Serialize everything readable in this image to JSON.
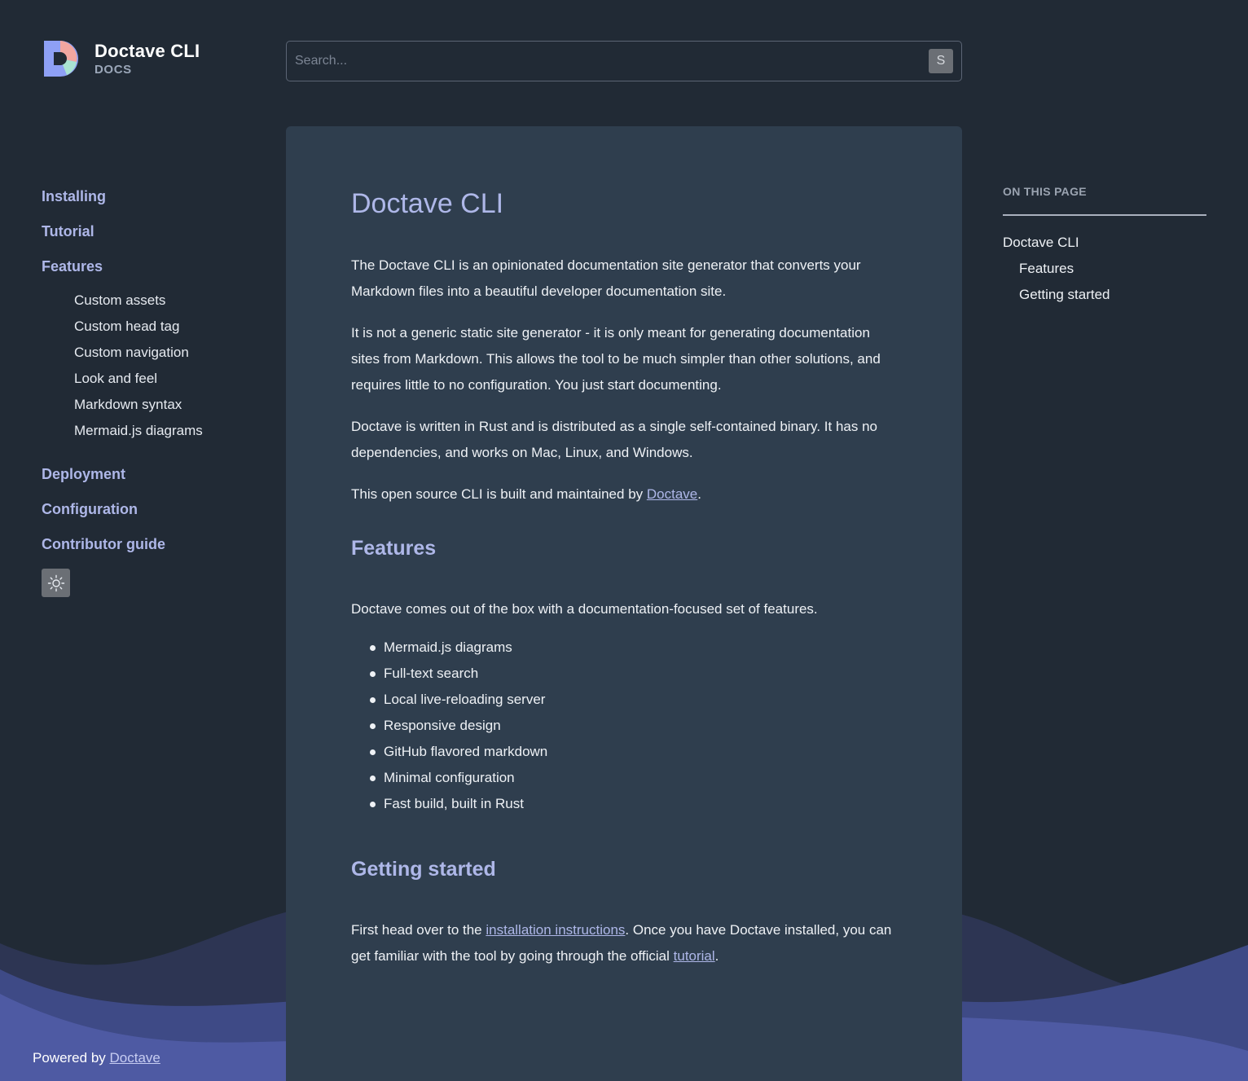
{
  "brand": {
    "title": "Doctave CLI",
    "subtitle": "DOCS"
  },
  "search": {
    "placeholder": "Search...",
    "shortcut_key": "S"
  },
  "sidebar": {
    "top_items": [
      {
        "label": "Installing"
      },
      {
        "label": "Tutorial"
      },
      {
        "label": "Features"
      }
    ],
    "feature_subitems": [
      {
        "label": "Custom assets"
      },
      {
        "label": "Custom head tag"
      },
      {
        "label": "Custom navigation"
      },
      {
        "label": "Look and feel"
      },
      {
        "label": "Markdown syntax"
      },
      {
        "label": "Mermaid.js diagrams"
      }
    ],
    "bottom_items": [
      {
        "label": "Deployment"
      },
      {
        "label": "Configuration"
      },
      {
        "label": "Contributor guide"
      }
    ],
    "theme_toggle_icon": "sun-icon"
  },
  "article": {
    "title": "Doctave CLI",
    "intro_1": "The Doctave CLI is an opinionated documentation site generator that converts your Markdown files into a beautiful developer documentation site.",
    "intro_2": "It is not a generic static site generator - it is only meant for generating documentation sites from Markdown. This allows the tool to be much simpler than other solutions, and requires little to no configuration. You just start documenting.",
    "intro_3": "Doctave is written in Rust and is distributed as a single self-contained binary. It has no dependencies, and works on Mac, Linux, and Windows.",
    "maintained_prefix": "This open source CLI is built and maintained by ",
    "maintained_link": "Doctave",
    "maintained_suffix": ".",
    "features_heading": "Features",
    "features_intro": "Doctave comes out of the box with a documentation-focused set of features.",
    "features_list": [
      "Mermaid.js diagrams",
      "Full-text search",
      "Local live-reloading server",
      "Responsive design",
      "GitHub flavored markdown",
      "Minimal configuration",
      "Fast build, built in Rust"
    ],
    "getting_started_heading": "Getting started",
    "gs_prefix": "First head over to the ",
    "gs_link_1": "installation instructions",
    "gs_middle": ". Once you have Doctave installed, you can get familiar with the tool by going through the official ",
    "gs_link_2": "tutorial",
    "gs_suffix": "."
  },
  "toc": {
    "title": "ON THIS PAGE",
    "items": [
      {
        "label": "Doctave CLI"
      },
      {
        "label": "Features"
      },
      {
        "label": "Getting started"
      }
    ]
  },
  "footer": {
    "prefix": "Powered by ",
    "link": "Doctave"
  },
  "colors": {
    "background": "#212a35",
    "card": "#2f3e4e",
    "accent": "#aeb7e8",
    "wave": "#4e5aa3"
  }
}
